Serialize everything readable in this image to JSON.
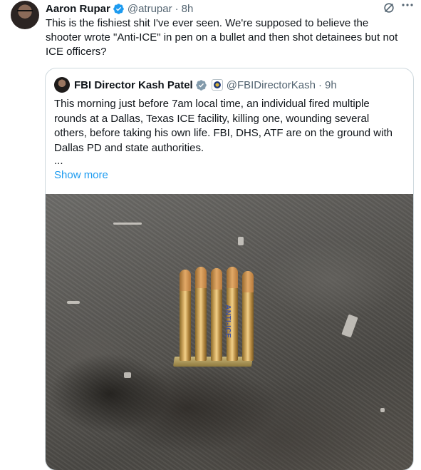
{
  "tweet": {
    "author_name": "Aaron Rupar",
    "handle": "@atrupar",
    "separator": "·",
    "time": "8h",
    "text": "This is the fishiest shit I've ever seen. We're supposed to believe the\nshooter wrote \"Anti-ICE\" in pen on a bullet and then shot detainees but not\nICE officers?"
  },
  "quote": {
    "author_name": "FBI Director Kash Patel",
    "handle": "@FBIDirectorKash",
    "separator": "·",
    "time": "9h",
    "text": "This morning just before 7am local time, an individual fired multiple\nrounds at a Dallas, Texas ICE facility, killing one, wounding several\nothers, before taking his own life. FBI, DHS, ATF are on the ground with\nDallas PD and state authorities.",
    "ellipsis": "...",
    "show_more": "Show more",
    "image_inscription": "ANTI-ICE"
  },
  "colors": {
    "verified_blue": "#1d9bf0",
    "gov_gray": "#829aab",
    "link_blue": "#1d9bf0",
    "secondary_text": "#536471"
  },
  "icons": [
    "verified-badge-icon",
    "grok-icon",
    "more-options-icon",
    "government-badge-icon",
    "agency-badge-icon"
  ]
}
